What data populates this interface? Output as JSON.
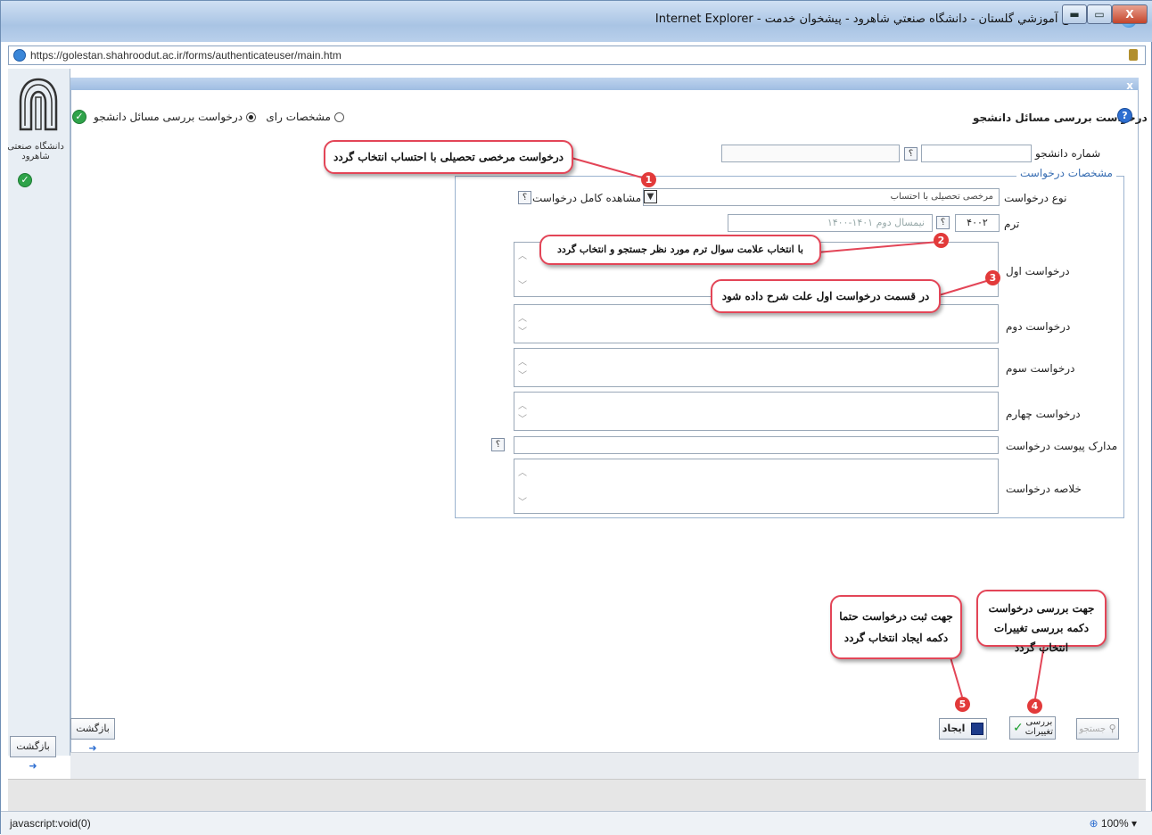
{
  "window": {
    "title": "سامانه جامع آموزشي گلستان - دانشگاه صنعتي شاهرود - پيشخوان خدمت - Internet Explorer",
    "minimize_label": "▬",
    "maximize_label": "▭",
    "close_label": "X"
  },
  "address": {
    "url": "https://golestan.shahroodut.ac.ir/forms/authenticateuser/main.htm"
  },
  "sidebar": {
    "logo_text": "دانشگاه صنعتی شاهرود",
    "back_label": "بازگشت"
  },
  "form": {
    "title": "درخواست بررسی مسائل دانشجو",
    "view_options": [
      {
        "label": "مشخصات رای",
        "selected": false
      },
      {
        "label": "درخواست بررسی مسائل دانشجو",
        "selected": true
      }
    ],
    "student_number_label": "شماره دانشجو",
    "student_number_value": "",
    "panel_title": "مشخصات درخواست",
    "request_type_label": "نوع درخواست",
    "request_type_value": "مرخصی تحصیلی با احتساب",
    "view_full_request_label": "مشاهده کامل درخواست",
    "term_label": "ترم",
    "term_value": "۴۰۰۲",
    "term_description": "نيمسال دوم ۱۴۰۱-۱۴۰۰",
    "request1_label": "درخواست اول",
    "request2_label": "درخواست دوم",
    "request3_label": "درخواست سوم",
    "request4_label": "درخواست چهارم",
    "attachments_label": "مدارک پیوست درخواست",
    "summary_label": "خلاصه درخواست",
    "q_mark": "؟"
  },
  "toolbar": {
    "search_label": "جستجو",
    "review_label": "بررسی تغییرات",
    "create_label": "ایجاد",
    "back_label": "بازگشت"
  },
  "callouts": {
    "c1": "درخواست مرخصی تحصیلی با احتساب انتخاب گردد",
    "c2": "با انتخاب علامت سوال ترم مورد نظر جستجو و انتخاب گردد",
    "c3": "در قسمت درخواست اول علت شرح داده شود",
    "c4": "جهت بررسی درخواست دکمه بررسی تغییرات انتخاب گردد",
    "c5": "جهت ثبت درخواست حتما دکمه ایجاد انتخاب گردد",
    "badges": [
      "1",
      "2",
      "3",
      "4",
      "5"
    ]
  },
  "statusbar": {
    "text": "javascript:void(0)",
    "zoom": "100%"
  },
  "colors": {
    "callout_border": "#e34557",
    "badge": "#e23a3a",
    "frame_accent": "#9fbde2"
  }
}
